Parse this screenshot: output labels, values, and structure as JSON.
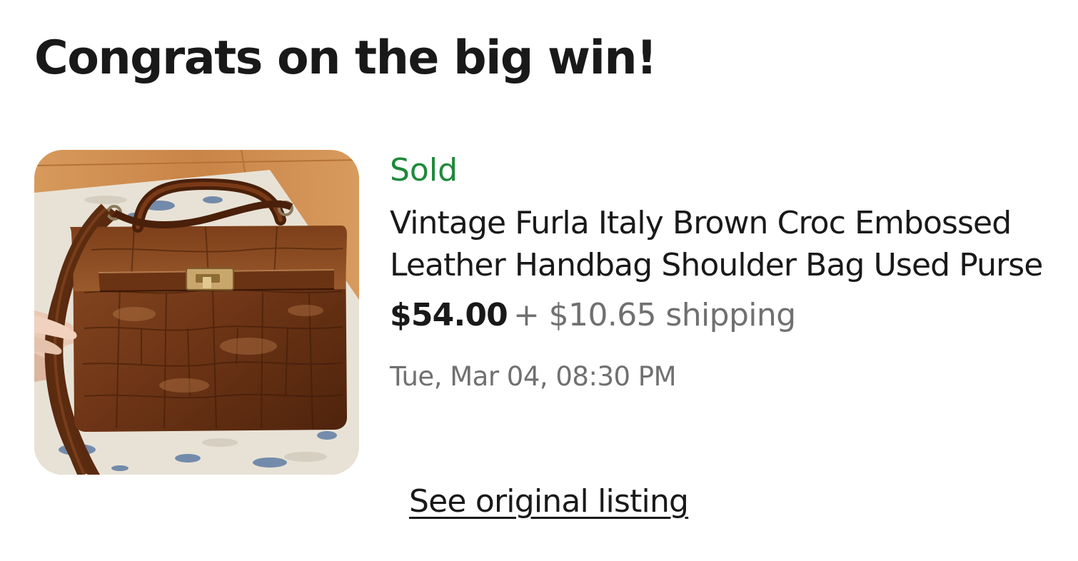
{
  "header": {
    "title": "Congrats on the big win!"
  },
  "item": {
    "image_subject": "brown croc embossed leather handbag",
    "status": "Sold",
    "title": "Vintage Furla Italy Brown Croc Embossed Leather Handbag Shoulder Bag Used Purse",
    "price": "$54.00",
    "shipping": "+ $10.65 shipping",
    "date": "Tue, Mar 04, 08:30 PM"
  },
  "actions": {
    "see_original_label": "See original listing"
  },
  "colors": {
    "status_green": "#1e8a3a",
    "text_primary": "#191919",
    "text_secondary": "#707070",
    "background": "#ffffff"
  }
}
